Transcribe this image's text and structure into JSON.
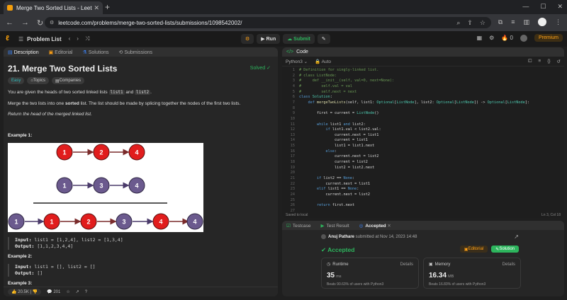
{
  "browser": {
    "tab_title": "Merge Two Sorted Lists - Leet",
    "url": "leetcode.com/problems/merge-two-sorted-lists/submissions/1098542002/"
  },
  "toolbar": {
    "problem_list": "Problem List",
    "run": "Run",
    "submit": "Submit",
    "streak": "0",
    "premium": "Premium"
  },
  "left_tabs": [
    "Description",
    "Editorial",
    "Solutions",
    "Submissions"
  ],
  "problem": {
    "title": "21. Merge Two Sorted Lists",
    "status": "Solved",
    "tags": [
      "Easy",
      "Topics",
      "Companies"
    ],
    "p1_a": "You are given the heads of two sorted linked lists ",
    "p1_c1": "list1",
    "p1_b": " and ",
    "p1_c2": "list2",
    "p1_d": ".",
    "p2_a": "Merge the two lists into one ",
    "p2_b": "sorted",
    "p2_c": " list. The list should be made by splicing together the nodes of the first two lists.",
    "p3": "Return the head of the merged linked list.",
    "example1": "Example 1:",
    "example2": "Example 2:",
    "example3": "Example 3:",
    "ex1_input_label": "Input:",
    "ex1_input": " list1 = [1,2,4], list2 = [1,3,4]",
    "ex1_output_label": "Output:",
    "ex1_output": " [1,1,2,3,4,4]",
    "ex2_input_label": "Input:",
    "ex2_input": " list1 = [], list2 = []",
    "ex2_output_label": "Output:",
    "ex2_output": " []"
  },
  "diagram": {
    "row1": [
      "1",
      "2",
      "4"
    ],
    "row2": [
      "1",
      "3",
      "4"
    ],
    "row3": [
      "1",
      "1",
      "2",
      "3",
      "4",
      "4"
    ]
  },
  "left_footer": {
    "likes": "20.5K",
    "comments": "201"
  },
  "editor": {
    "header": "Code",
    "language": "Python3",
    "mode": "Auto",
    "saved": "Saved to local",
    "position": "Ln 3, Col 18",
    "lines": [
      "# Definition for singly-linked list.",
      "# class ListNode:",
      "#     def __init__(self, val=0, next=None):",
      "#         self.val = val",
      "#         self.next = next",
      "class Solution:",
      "    def mergeTwoLists(self, list1: Optional[ListNode], list2: Optional[ListNode]) -> Optional[ListNode]:",
      "",
      "        first = current = ListNode()",
      "",
      "        while list1 and list2:",
      "            if list1.val < list2.val:",
      "                current.next = list1",
      "                current = list1",
      "                list1 = list1.next",
      "            else:",
      "                current.next = list2",
      "                current = list2",
      "                list2 = list2.next",
      "",
      "        if list2 == None:",
      "            current.next = list1",
      "        elif list1 == None:",
      "            current.next = list2",
      "",
      "        return first.next",
      ""
    ]
  },
  "result": {
    "tabs": [
      "Testcase",
      "Test Result",
      "Accepted"
    ],
    "user": "Anuj Pathare",
    "submitted": " submitted at Nov 14, 2023 14:48",
    "verdict": "Accepted",
    "editorial": "Editorial",
    "solution": "Solution",
    "runtime_label": "Runtime",
    "runtime_value": "35",
    "runtime_unit": "ms",
    "runtime_beats": "Beats 90.63% of users with Python3",
    "memory_label": "Memory",
    "memory_value": "16.34",
    "memory_unit": "MB",
    "memory_beats": "Beats 16.83% of users with Python3",
    "details": "Details"
  }
}
